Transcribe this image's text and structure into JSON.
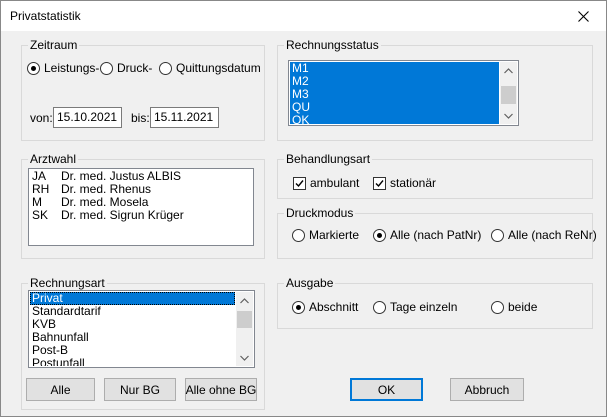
{
  "window": {
    "title": "Privatstatistik"
  },
  "zeitraum": {
    "legend": "Zeitraum",
    "options": [
      "Leistungs-",
      "Druck-",
      "Quittungsdatum"
    ],
    "selected_index": 0,
    "von_label": "von:",
    "von_value": "15.10.2021",
    "bis_label": "bis:",
    "bis_value": "15.11.2021"
  },
  "rechnungsstatus": {
    "legend": "Rechnungsstatus",
    "items": [
      "M1",
      "M2",
      "M3",
      "QU",
      "OK"
    ]
  },
  "arztwahl": {
    "legend": "Arztwahl",
    "items": [
      {
        "code": "JA",
        "name": "Dr. med. Justus ALBIS"
      },
      {
        "code": "RH",
        "name": "Dr. med. Rhenus"
      },
      {
        "code": "M",
        "name": "Dr. med. Mosela"
      },
      {
        "code": "SK",
        "name": "Dr. med. Sigrun Krüger"
      }
    ]
  },
  "behandlungsart": {
    "legend": "Behandlungsart",
    "ambulant": {
      "label": "ambulant",
      "checked": true
    },
    "stationaer": {
      "label": "stationär",
      "checked": true
    }
  },
  "druckmodus": {
    "legend": "Druckmodus",
    "options": [
      "Markierte",
      "Alle (nach PatNr)",
      "Alle (nach ReNr)"
    ],
    "selected_index": 1
  },
  "rechnungsart": {
    "legend": "Rechnungsart",
    "items": [
      "Privat",
      "Standardtarif",
      "KVB",
      "Bahnunfall",
      "Post-B",
      "Postunfall"
    ],
    "selected_index": 0,
    "buttons": {
      "alle": "Alle",
      "nur_bg": "Nur BG",
      "alle_ohne_bg": "Alle ohne BG"
    }
  },
  "ausgabe": {
    "legend": "Ausgabe",
    "options": [
      "Abschnitt",
      "Tage einzeln",
      "beide"
    ],
    "selected_index": 0
  },
  "footer": {
    "ok": "OK",
    "abbruch": "Abbruch"
  },
  "colors": {
    "selection": "#0078d7",
    "window_bg": "#f0f0f0"
  }
}
